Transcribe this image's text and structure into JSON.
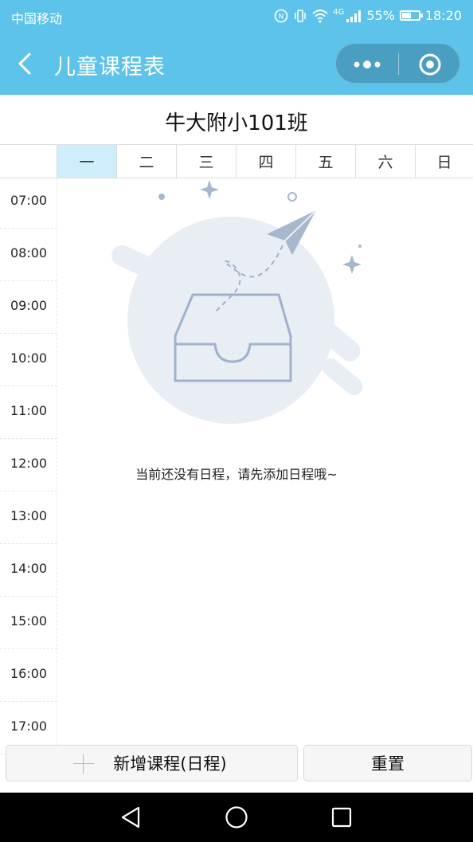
{
  "status_bar": {
    "carrier": "中国移动",
    "network": "4G",
    "battery": "55%",
    "battery_level": 0.55,
    "time": "18:20"
  },
  "header": {
    "title": "儿童课程表",
    "back_icon": "chevron-left-icon",
    "more_icon": "more-dots-icon",
    "close_icon": "target-circle-icon",
    "bg_color": "#5ec3ea"
  },
  "schedule": {
    "class_name": "牛大附小101班",
    "days": [
      "一",
      "二",
      "三",
      "四",
      "五",
      "六",
      "日"
    ],
    "active_day_index": 0,
    "times": [
      "07:00",
      "08:00",
      "09:00",
      "10:00",
      "11:00",
      "12:00",
      "13:00",
      "14:00",
      "15:00",
      "16:00",
      "17:00"
    ],
    "empty_message": "当前还没有日程，请先添加日程哦~",
    "empty_icon": "empty-inbox-paper-plane-icon"
  },
  "actions": {
    "add_label": "新增课程(日程)",
    "add_icon": "plus-icon",
    "reset_label": "重置"
  },
  "system_nav": {
    "back_icon": "triangle-back-icon",
    "home_icon": "circle-home-icon",
    "recents_icon": "square-recents-icon"
  }
}
